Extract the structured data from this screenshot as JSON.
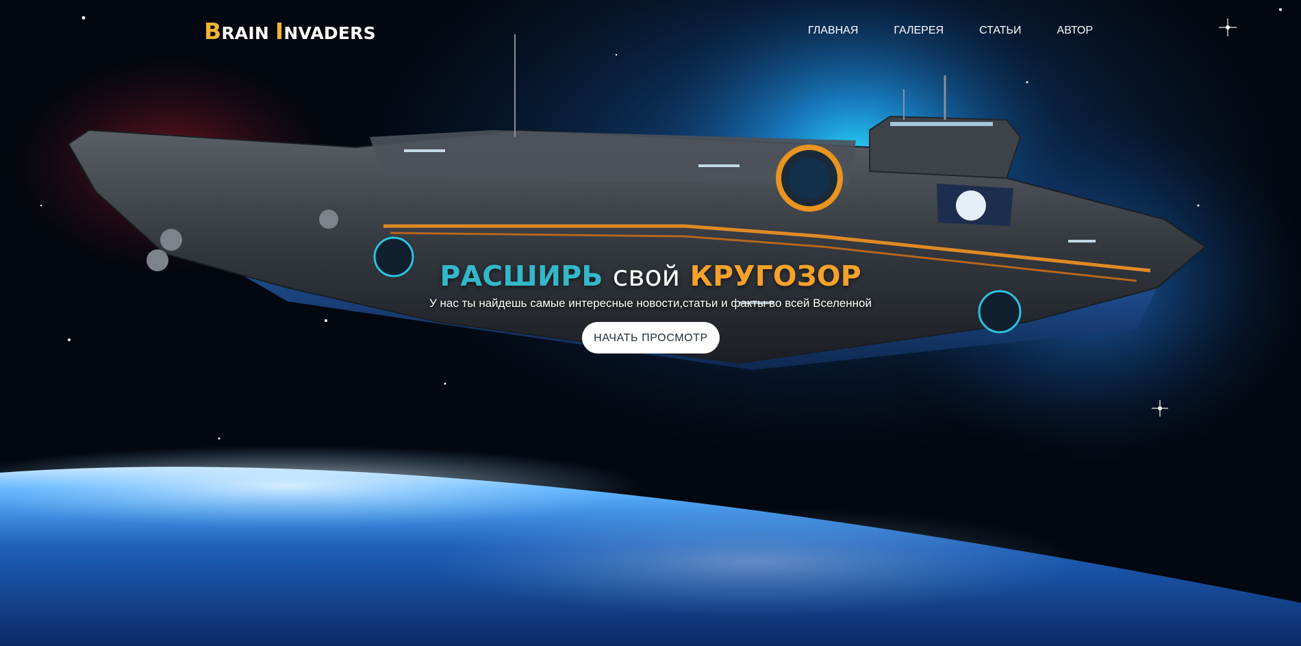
{
  "header": {
    "logo": {
      "part1_cap": "B",
      "part1_rest": "RAIN",
      "part2_cap": "I",
      "part2_rest": "NVADERS"
    },
    "nav": [
      {
        "label": "ГЛАВНАЯ"
      },
      {
        "label": "ГАЛЕРЕЯ"
      },
      {
        "label": "СТАТЬИ"
      },
      {
        "label": "АВТОР"
      }
    ]
  },
  "hero": {
    "title_word1": "РАСШИРЬ",
    "title_word2": "свой",
    "title_word3": "КРУГОЗОР",
    "subtitle": "У нас ты найдешь самые интересные новости,статьи и факты во всей Вселенной",
    "cta_label": "НАЧАТЬ ПРОСМОТР"
  },
  "colors": {
    "logo_accent": "#f1b532",
    "title_teal": "#33b7c9",
    "title_orange": "#f5a12a",
    "space_dark": "#02060d",
    "nebula_blue": "#1a8fd8",
    "planet_glow": "#9fd4ff"
  },
  "icons": [
    "spaceship-illustration",
    "planet-illustration",
    "star-sparkle"
  ]
}
